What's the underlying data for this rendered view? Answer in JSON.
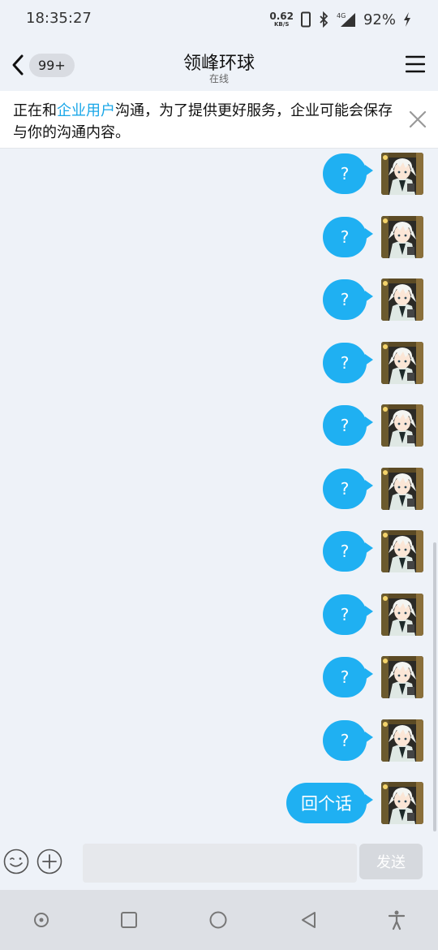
{
  "status_bar": {
    "time": "18:35:27",
    "net_speed": "0.62",
    "net_unit": "KB/S",
    "battery": "92%"
  },
  "nav": {
    "badge": "99+",
    "title": "领峰环球",
    "subtitle": "在线"
  },
  "notice": {
    "before": "正在和",
    "highlight": "企业用户",
    "after": "沟通，为了提供更好服务，企业可能会保存与你的沟通内容。"
  },
  "messages": [
    "?",
    "?",
    "?",
    "?",
    "?",
    "?",
    "?",
    "?",
    "?",
    "?",
    "回个话"
  ],
  "composer": {
    "input_value": "",
    "send_label": "发送"
  },
  "colors": {
    "bubble": "#1fb0f2",
    "highlight": "#1aa7e8",
    "background": "#eef2f8"
  }
}
